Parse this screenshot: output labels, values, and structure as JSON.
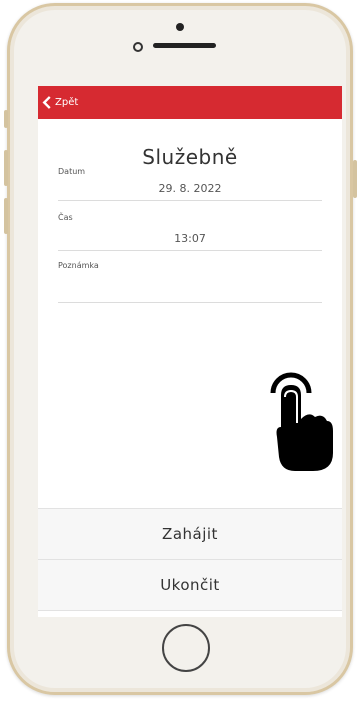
{
  "header": {
    "back_label": "Zpět"
  },
  "main": {
    "title": "Služebně",
    "fields": [
      {
        "label": "Datum",
        "value": "29. 8. 2022"
      },
      {
        "label": "Čas",
        "value": "13:07"
      },
      {
        "label": "Poznámka",
        "value": ""
      }
    ]
  },
  "actions": {
    "start_label": "Zahájit",
    "end_label": "Ukončit"
  },
  "colors": {
    "accent": "#d62a31",
    "frame": "#d9c7a3"
  },
  "icons": {
    "back": "chevron-left-icon",
    "pointer": "tap-hand-icon"
  }
}
